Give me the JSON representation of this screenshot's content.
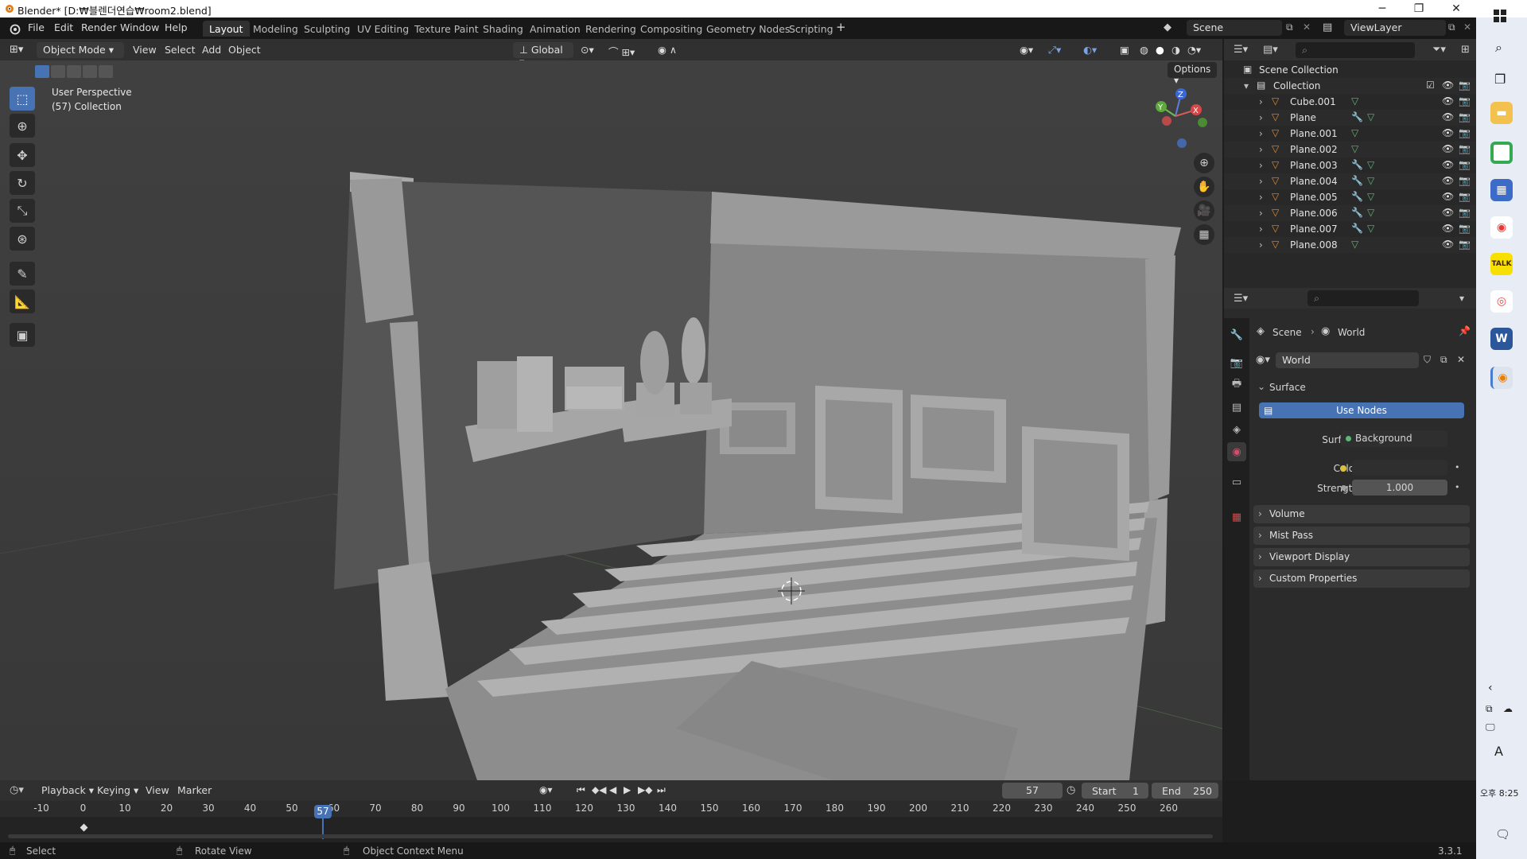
{
  "window": {
    "title": "Blender* [D:₩블렌더연습₩room2.blend]"
  },
  "topbar": {
    "menus": [
      "File",
      "Edit",
      "Render",
      "Window",
      "Help"
    ],
    "workspaces": [
      "Layout",
      "Modeling",
      "Sculpting",
      "UV Editing",
      "Texture Paint",
      "Shading",
      "Animation",
      "Rendering",
      "Compositing",
      "Geometry Nodes",
      "Scripting"
    ],
    "active_workspace": "Layout",
    "scene": "Scene",
    "view_layer": "ViewLayer"
  },
  "viewport": {
    "mode": "Object Mode",
    "menus": [
      "View",
      "Select",
      "Add",
      "Object"
    ],
    "transform_orientation": "Global",
    "options_label": "Options",
    "overlay_title": "User Perspective",
    "overlay_sub": "(57) Collection",
    "gizmo": {
      "x": "X",
      "y": "Y",
      "z": "Z"
    }
  },
  "outliner": {
    "root": "Scene Collection",
    "collection": "Collection",
    "objects": [
      "Cube.001",
      "Plane",
      "Plane.001",
      "Plane.002",
      "Plane.003",
      "Plane.004",
      "Plane.005",
      "Plane.006",
      "Plane.007",
      "Plane.008"
    ]
  },
  "properties": {
    "breadcrumb_scene": "Scene",
    "breadcrumb_world": "World",
    "world_name": "World",
    "surface_panel": "Surface",
    "use_nodes": "Use Nodes",
    "surface_label": "Surface",
    "surface_value": "Background",
    "color_label": "Color",
    "strength_label": "Strength",
    "strength_value": "1.000",
    "panels": [
      "Volume",
      "Mist Pass",
      "Viewport Display",
      "Custom Properties"
    ]
  },
  "timeline": {
    "menus": [
      "Playback",
      "Keying",
      "View",
      "Marker"
    ],
    "current_frame": "57",
    "start_label": "Start",
    "start_value": "1",
    "end_label": "End",
    "end_value": "250",
    "ticks": [
      "-10",
      "0",
      "10",
      "20",
      "30",
      "40",
      "50",
      "60",
      "70",
      "80",
      "90",
      "100",
      "110",
      "120",
      "130",
      "140",
      "150",
      "160",
      "170",
      "180",
      "190",
      "200",
      "210",
      "220",
      "230",
      "240",
      "250",
      "260"
    ]
  },
  "statusbar": {
    "select": "Select",
    "rotate": "Rotate View",
    "context": "Object Context Menu",
    "version": "3.3.1"
  },
  "taskbar": {
    "time": "오후 8:25",
    "ime": "A"
  },
  "colors": {
    "accent": "#4772b3",
    "object_orange": "#e8892c",
    "mesh_green": "#5fb67a",
    "modifier_blue": "#6f8fe0"
  }
}
